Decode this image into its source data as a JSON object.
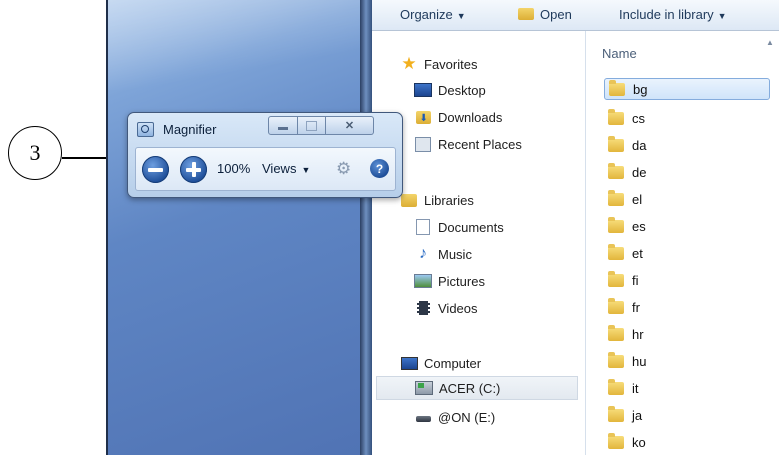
{
  "callout": {
    "number": "3"
  },
  "explorer": {
    "toolbar": {
      "organize": "Organize",
      "open": "Open",
      "include_in_library": "Include in library"
    },
    "nav": {
      "favorites": {
        "label": "Favorites",
        "items": [
          "Desktop",
          "Downloads",
          "Recent Places"
        ]
      },
      "libraries": {
        "label": "Libraries",
        "items": [
          "Documents",
          "Music",
          "Pictures",
          "Videos"
        ]
      },
      "computer": {
        "label": "Computer",
        "items": [
          "ACER (C:)",
          "@ON (E:)"
        ]
      }
    },
    "filelist": {
      "column_name": "Name",
      "folders": [
        "bg",
        "cs",
        "da",
        "de",
        "el",
        "es",
        "et",
        "fi",
        "fr",
        "hr",
        "hu",
        "it",
        "ja",
        "ko"
      ]
    }
  },
  "magnifier": {
    "title": "Magnifier",
    "zoom": "100%",
    "views_label": "Views",
    "buttons": {
      "minimize": "▭",
      "maximize": "▢",
      "close": "✕"
    }
  }
}
